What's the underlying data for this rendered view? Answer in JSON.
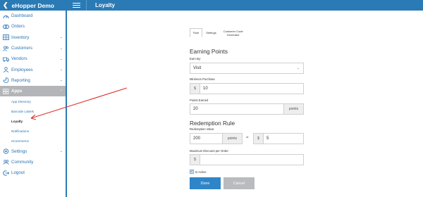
{
  "app": {
    "brand": "eHopper Demo",
    "page_title": "Loyalty"
  },
  "sidebar": {
    "items": [
      {
        "label": "Dashboard",
        "icon": "dashboard-icon",
        "expandable": false
      },
      {
        "label": "Orders",
        "icon": "orders-icon",
        "expandable": false
      },
      {
        "label": "Inventory",
        "icon": "inventory-icon",
        "expandable": true
      },
      {
        "label": "Customers",
        "icon": "customers-icon",
        "expandable": true
      },
      {
        "label": "Vendors",
        "icon": "vendors-icon",
        "expandable": true
      },
      {
        "label": "Employees",
        "icon": "employees-icon",
        "expandable": true
      },
      {
        "label": "Reporting",
        "icon": "reporting-icon",
        "expandable": true
      },
      {
        "label": "Apps",
        "icon": "apps-icon",
        "expandable": true,
        "active": true
      }
    ],
    "apps_sub": [
      "App Directory",
      "Barcode Labels",
      "Loyalty",
      "Notifications",
      "eCommerce"
    ],
    "bottom_items": [
      {
        "label": "Settings",
        "icon": "settings-icon",
        "expandable": true
      },
      {
        "label": "Community",
        "icon": "community-icon",
        "expandable": false
      },
      {
        "label": "Logout",
        "icon": "logout-icon",
        "expandable": false
      }
    ]
  },
  "tabs": {
    "rule": "Rule",
    "settings": "Settings",
    "customer_code_line1": "Customer Code",
    "customer_code_line2": "Generator"
  },
  "earning": {
    "title": "Earning Points",
    "earn_by_label": "Earn By:",
    "earn_by_value": "Visit",
    "min_purchase_label": "Minimum Purchase",
    "min_purchase_prefix": "$",
    "min_purchase_value": "10",
    "points_earned_label": "Points Earned",
    "points_earned_value": "20",
    "points_earned_suffix": "points"
  },
  "redemption": {
    "title": "Redemption Rule",
    "value_label": "Redemption Value:",
    "points_value": "200",
    "points_suffix": "points",
    "equals": "=",
    "dollar_prefix": "$",
    "dollar_value": "5",
    "max_discount_label": "Maximum Discount per Order:",
    "max_discount_prefix": "$",
    "max_discount_value": ""
  },
  "is_active_label": "Is Active",
  "buttons": {
    "done": "Done",
    "cancel": "Cancel"
  },
  "colors": {
    "brand": "#2a7ab5",
    "primary_button": "#2e86c9",
    "annotation_arrow": "#e0302b"
  }
}
